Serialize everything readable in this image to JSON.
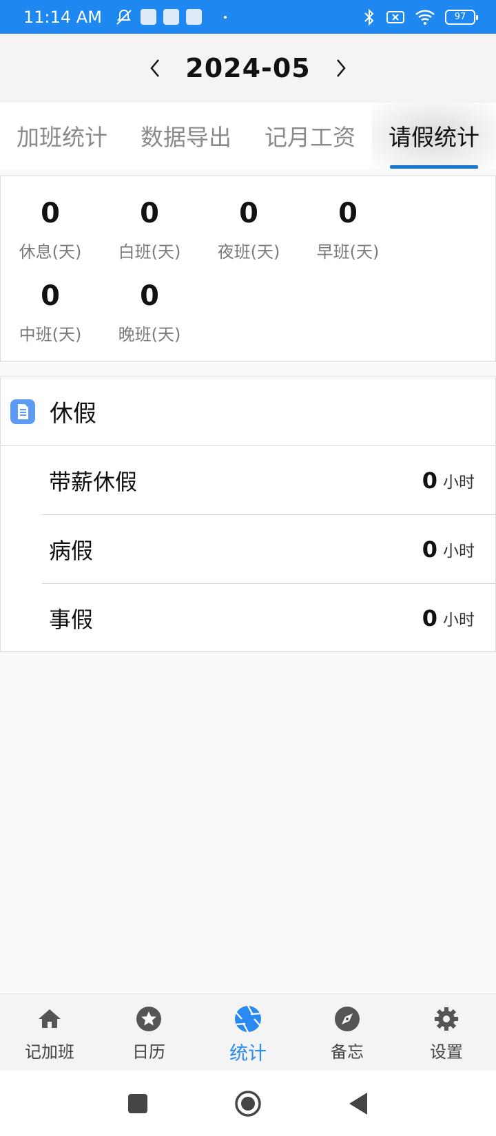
{
  "status_bar": {
    "time": "11:14 AM",
    "battery": "97"
  },
  "header": {
    "month": "2024-05"
  },
  "tabs": [
    {
      "label": "加班统计"
    },
    {
      "label": "数据导出"
    },
    {
      "label": "记月工资"
    },
    {
      "label": "请假统计",
      "active": true
    }
  ],
  "stats": [
    {
      "value": "0",
      "label": "休息(天)"
    },
    {
      "value": "0",
      "label": "白班(天)"
    },
    {
      "value": "0",
      "label": "夜班(天)"
    },
    {
      "value": "0",
      "label": "早班(天)"
    },
    {
      "value": "0",
      "label": "中班(天)"
    },
    {
      "value": "0",
      "label": "晚班(天)"
    }
  ],
  "leave": {
    "title": "休假",
    "rows": [
      {
        "name": "带薪休假",
        "value": "0",
        "unit": "小时"
      },
      {
        "name": "病假",
        "value": "0",
        "unit": "小时"
      },
      {
        "name": "事假",
        "value": "0",
        "unit": "小时"
      }
    ]
  },
  "bottom_nav": [
    {
      "label": "记加班",
      "icon": "home-icon"
    },
    {
      "label": "日历",
      "icon": "star-icon"
    },
    {
      "label": "统计",
      "icon": "aperture-icon",
      "active": true
    },
    {
      "label": "备忘",
      "icon": "compass-icon"
    },
    {
      "label": "设置",
      "icon": "gear-icon"
    }
  ],
  "colors": {
    "status_bar": "#1e88f0",
    "accent": "#2a8af0",
    "tab_indicator": "#1976d2",
    "doc_icon": "#5b9bf5"
  }
}
